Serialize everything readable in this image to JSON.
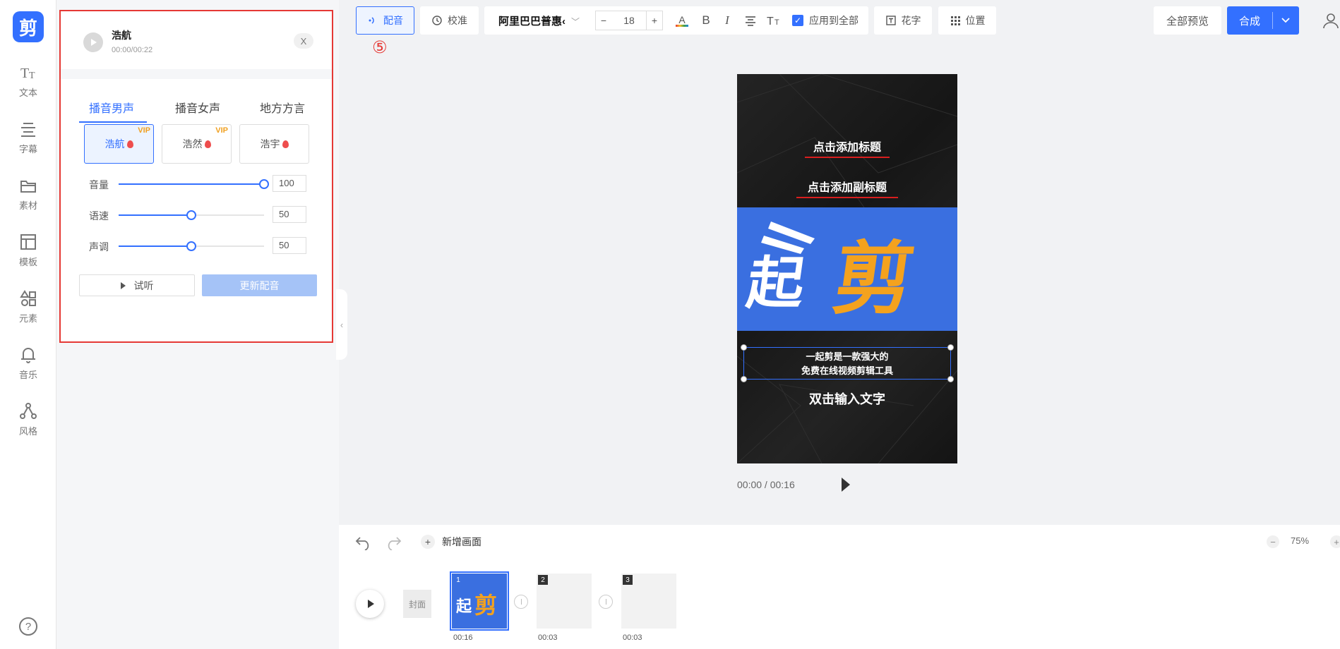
{
  "app": {
    "logo_text": "剪"
  },
  "sidebar": {
    "items": [
      {
        "label": "文本",
        "icon": "text-icon"
      },
      {
        "label": "字幕",
        "icon": "subtitle-icon"
      },
      {
        "label": "素材",
        "icon": "folder-icon"
      },
      {
        "label": "模板",
        "icon": "template-icon"
      },
      {
        "label": "元素",
        "icon": "elements-icon"
      },
      {
        "label": "音乐",
        "icon": "bell-icon"
      },
      {
        "label": "风格",
        "icon": "style-icon"
      }
    ],
    "help_icon": "help-icon"
  },
  "voice_panel": {
    "track_name": "浩航",
    "track_time": "00:00/00:22",
    "close_label": "X",
    "tabs": [
      "播音男声",
      "播音女声",
      "地方方言"
    ],
    "active_tab": 0,
    "voices": [
      {
        "name": "浩航",
        "vip": "VIP",
        "selected": true
      },
      {
        "name": "浩然",
        "vip": "VIP",
        "selected": false
      },
      {
        "name": "浩宇",
        "vip": "",
        "selected": false
      }
    ],
    "sliders": [
      {
        "label": "音量",
        "value": "100",
        "percent": 100
      },
      {
        "label": "语速",
        "value": "50",
        "percent": 50
      },
      {
        "label": "声调",
        "value": "50",
        "percent": 50
      }
    ],
    "listen_label": "试听",
    "update_label": "更新配音",
    "collapse_icon": "‹"
  },
  "toolbar": {
    "dub_label": "配音",
    "annotation_marker": "⑤",
    "calibrate_label": "校准",
    "font_name": "阿里巴巴普惠‹",
    "font_size": "18",
    "minus": "−",
    "plus": "+",
    "color_letter": "A",
    "bold": "B",
    "italic": "I",
    "apply_all_label": "应用到全部",
    "apply_all_checked": true,
    "fancy_text_label": "花字",
    "position_label": "位置",
    "preview_all_label": "全部预览",
    "compose_label": "合成"
  },
  "canvas": {
    "title": "点击添加标题",
    "subtitle": "点击添加副标题",
    "banner_text": "起剪",
    "body_line1": "一起剪是一款强大的",
    "body_line2": "免费在线视频剪辑工具",
    "placeholder": "双击输入文字",
    "time": "00:00 / 00:16",
    "colors": {
      "banner": "#3a6fe0",
      "accent_orange": "#f4a21e",
      "underline_red": "#d81e1e"
    }
  },
  "timeline": {
    "add_scene_label": "新增画面",
    "zoom_minus": "−",
    "zoom_value": "75%",
    "zoom_plus": "+",
    "cover_label": "封面",
    "clips": [
      {
        "num": "1",
        "duration": "00:16",
        "selected": true,
        "thumb_text": "起剪"
      },
      {
        "num": "2",
        "duration": "00:03",
        "selected": false
      },
      {
        "num": "3",
        "duration": "00:03",
        "selected": false
      }
    ]
  }
}
